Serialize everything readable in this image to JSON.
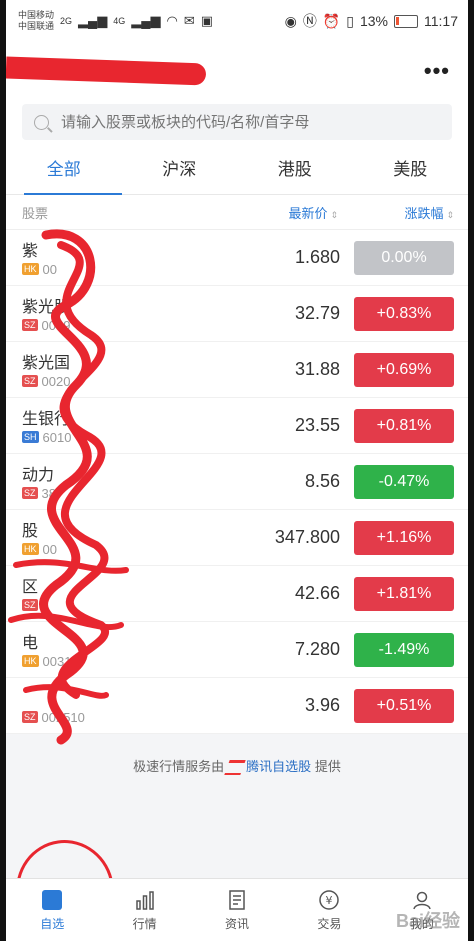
{
  "status": {
    "carrier1": "中国移动",
    "carrier2": "中国联通",
    "net1": "2G",
    "net2": "4G",
    "battery": "13%",
    "time": "11:17"
  },
  "header": {
    "more": "•••"
  },
  "search": {
    "placeholder": "请输入股票或板块的代码/名称/首字母"
  },
  "tabs": [
    {
      "label": "全部"
    },
    {
      "label": "沪深"
    },
    {
      "label": "港股"
    },
    {
      "label": "美股"
    }
  ],
  "columns": {
    "name": "股票",
    "price": "最新价",
    "change": "涨跌幅",
    "sort": "⇕"
  },
  "stocks": [
    {
      "name": "紫",
      "market": "HK",
      "code": "00",
      "price": "1.680",
      "change": "0.00%",
      "dir": "flat"
    },
    {
      "name": "紫光股",
      "market": "SZ",
      "code": "0009",
      "price": "32.79",
      "change": "+0.83%",
      "dir": "up"
    },
    {
      "name": "紫光国",
      "market": "SZ",
      "code": "0020",
      "price": "31.88",
      "change": "+0.69%",
      "dir": "up"
    },
    {
      "name": "生银行",
      "market": "SH",
      "code": "6010",
      "price": "23.55",
      "change": "+0.81%",
      "dir": "up"
    },
    {
      "name": "动力",
      "market": "SZ",
      "code": "38",
      "price": "8.56",
      "change": "-0.47%",
      "dir": "down"
    },
    {
      "name": "股",
      "market": "HK",
      "code": "00",
      "price": "347.800",
      "change": "+1.16%",
      "dir": "up"
    },
    {
      "name": "区",
      "market": "SZ",
      "code": "3",
      "price": "42.66",
      "change": "+1.81%",
      "dir": "up"
    },
    {
      "name": "电",
      "market": "HK",
      "code": "0031",
      "price": "7.280",
      "change": "-1.49%",
      "dir": "down"
    },
    {
      "name": "",
      "market": "SZ",
      "code": "002510",
      "price": "3.96",
      "change": "+0.51%",
      "dir": "up"
    }
  ],
  "footer": {
    "prefix": "极速行情服务由",
    "brand": "腾讯自选股",
    "suffix": "提供"
  },
  "nav": [
    {
      "label": "自选"
    },
    {
      "label": "行情"
    },
    {
      "label": "资讯"
    },
    {
      "label": "交易"
    },
    {
      "label": "我的"
    }
  ],
  "watermark": "Bai经验"
}
